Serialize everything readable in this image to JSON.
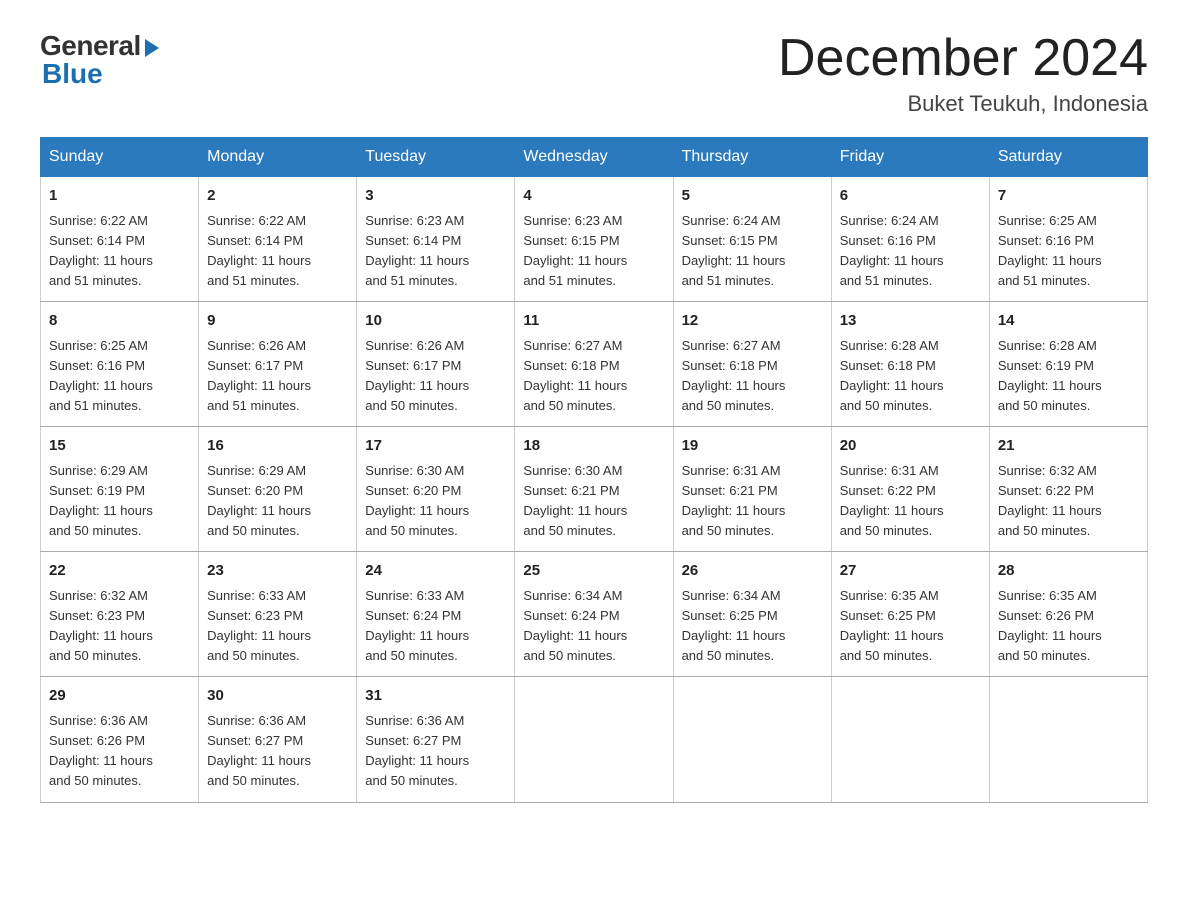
{
  "logo": {
    "general": "General",
    "blue": "Blue"
  },
  "title": "December 2024",
  "location": "Buket Teukuh, Indonesia",
  "days_of_week": [
    "Sunday",
    "Monday",
    "Tuesday",
    "Wednesday",
    "Thursday",
    "Friday",
    "Saturday"
  ],
  "weeks": [
    [
      {
        "day": "1",
        "sunrise": "6:22 AM",
        "sunset": "6:14 PM",
        "daylight": "11 hours and 51 minutes."
      },
      {
        "day": "2",
        "sunrise": "6:22 AM",
        "sunset": "6:14 PM",
        "daylight": "11 hours and 51 minutes."
      },
      {
        "day": "3",
        "sunrise": "6:23 AM",
        "sunset": "6:14 PM",
        "daylight": "11 hours and 51 minutes."
      },
      {
        "day": "4",
        "sunrise": "6:23 AM",
        "sunset": "6:15 PM",
        "daylight": "11 hours and 51 minutes."
      },
      {
        "day": "5",
        "sunrise": "6:24 AM",
        "sunset": "6:15 PM",
        "daylight": "11 hours and 51 minutes."
      },
      {
        "day": "6",
        "sunrise": "6:24 AM",
        "sunset": "6:16 PM",
        "daylight": "11 hours and 51 minutes."
      },
      {
        "day": "7",
        "sunrise": "6:25 AM",
        "sunset": "6:16 PM",
        "daylight": "11 hours and 51 minutes."
      }
    ],
    [
      {
        "day": "8",
        "sunrise": "6:25 AM",
        "sunset": "6:16 PM",
        "daylight": "11 hours and 51 minutes."
      },
      {
        "day": "9",
        "sunrise": "6:26 AM",
        "sunset": "6:17 PM",
        "daylight": "11 hours and 51 minutes."
      },
      {
        "day": "10",
        "sunrise": "6:26 AM",
        "sunset": "6:17 PM",
        "daylight": "11 hours and 50 minutes."
      },
      {
        "day": "11",
        "sunrise": "6:27 AM",
        "sunset": "6:18 PM",
        "daylight": "11 hours and 50 minutes."
      },
      {
        "day": "12",
        "sunrise": "6:27 AM",
        "sunset": "6:18 PM",
        "daylight": "11 hours and 50 minutes."
      },
      {
        "day": "13",
        "sunrise": "6:28 AM",
        "sunset": "6:18 PM",
        "daylight": "11 hours and 50 minutes."
      },
      {
        "day": "14",
        "sunrise": "6:28 AM",
        "sunset": "6:19 PM",
        "daylight": "11 hours and 50 minutes."
      }
    ],
    [
      {
        "day": "15",
        "sunrise": "6:29 AM",
        "sunset": "6:19 PM",
        "daylight": "11 hours and 50 minutes."
      },
      {
        "day": "16",
        "sunrise": "6:29 AM",
        "sunset": "6:20 PM",
        "daylight": "11 hours and 50 minutes."
      },
      {
        "day": "17",
        "sunrise": "6:30 AM",
        "sunset": "6:20 PM",
        "daylight": "11 hours and 50 minutes."
      },
      {
        "day": "18",
        "sunrise": "6:30 AM",
        "sunset": "6:21 PM",
        "daylight": "11 hours and 50 minutes."
      },
      {
        "day": "19",
        "sunrise": "6:31 AM",
        "sunset": "6:21 PM",
        "daylight": "11 hours and 50 minutes."
      },
      {
        "day": "20",
        "sunrise": "6:31 AM",
        "sunset": "6:22 PM",
        "daylight": "11 hours and 50 minutes."
      },
      {
        "day": "21",
        "sunrise": "6:32 AM",
        "sunset": "6:22 PM",
        "daylight": "11 hours and 50 minutes."
      }
    ],
    [
      {
        "day": "22",
        "sunrise": "6:32 AM",
        "sunset": "6:23 PM",
        "daylight": "11 hours and 50 minutes."
      },
      {
        "day": "23",
        "sunrise": "6:33 AM",
        "sunset": "6:23 PM",
        "daylight": "11 hours and 50 minutes."
      },
      {
        "day": "24",
        "sunrise": "6:33 AM",
        "sunset": "6:24 PM",
        "daylight": "11 hours and 50 minutes."
      },
      {
        "day": "25",
        "sunrise": "6:34 AM",
        "sunset": "6:24 PM",
        "daylight": "11 hours and 50 minutes."
      },
      {
        "day": "26",
        "sunrise": "6:34 AM",
        "sunset": "6:25 PM",
        "daylight": "11 hours and 50 minutes."
      },
      {
        "day": "27",
        "sunrise": "6:35 AM",
        "sunset": "6:25 PM",
        "daylight": "11 hours and 50 minutes."
      },
      {
        "day": "28",
        "sunrise": "6:35 AM",
        "sunset": "6:26 PM",
        "daylight": "11 hours and 50 minutes."
      }
    ],
    [
      {
        "day": "29",
        "sunrise": "6:36 AM",
        "sunset": "6:26 PM",
        "daylight": "11 hours and 50 minutes."
      },
      {
        "day": "30",
        "sunrise": "6:36 AM",
        "sunset": "6:27 PM",
        "daylight": "11 hours and 50 minutes."
      },
      {
        "day": "31",
        "sunrise": "6:36 AM",
        "sunset": "6:27 PM",
        "daylight": "11 hours and 50 minutes."
      },
      null,
      null,
      null,
      null
    ]
  ],
  "labels": {
    "sunrise": "Sunrise:",
    "sunset": "Sunset:",
    "daylight": "Daylight:"
  }
}
